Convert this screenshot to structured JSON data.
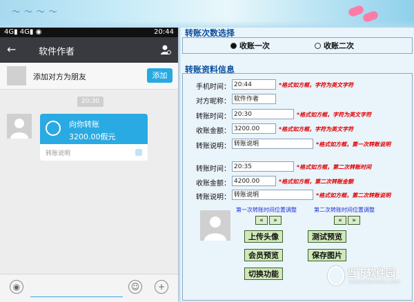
{
  "phone": {
    "status": {
      "left": "4G▮ 4G▮ ◉",
      "time": "20:44"
    },
    "title": "软件作者",
    "back_icon": "←",
    "friend": {
      "text": "添加对方为朋友",
      "button": "添加"
    },
    "time_pill": "20:30",
    "bubble": {
      "line1": "向你转账",
      "line2": "3200.00假元",
      "footer": "转账说明"
    },
    "input_icons": {
      "voice": "◉",
      "emoji": "☺",
      "plus": "+"
    }
  },
  "right": {
    "section1": "转账次数选择",
    "radio1": "收账一次",
    "radio2": "收账二次",
    "section2": "转账资料信息",
    "fields": [
      {
        "label": "手机时间：",
        "value": "20:44",
        "note": "*格式如方框，字符为英文字符"
      },
      {
        "label": "对方昵称：",
        "value": "软件作者",
        "note": ""
      },
      {
        "label": "转账时间：",
        "value": "20:30",
        "note": "*格式如方框，字符为英文字符"
      },
      {
        "label": "收账金额：",
        "value": "3200.00",
        "note": "*格式如方框，字符为英文字符"
      },
      {
        "label": "转账说明：",
        "value": "转账说明",
        "note": "*格式如方框，第一次转账说明"
      },
      {
        "label": "转账时间：",
        "value": "20:35",
        "note": "*格式如方框，第二次转账时间"
      },
      {
        "label": "收账金额：",
        "value": "4200.00",
        "note": "*格式如方框，第二次转账金额"
      },
      {
        "label": "转账说明：",
        "value": "转账说明",
        "note": "*格式如方框，第二次转账说明"
      }
    ],
    "adj1": "第一次转账时间位置调整",
    "adj2": "第二次转账时间位置调整",
    "arrow_left": "«",
    "arrow_right": "»",
    "buttons": {
      "upload": "上传头像",
      "test": "测试预览",
      "member": "会员预览",
      "save": "保存图片",
      "switch": "切换功能"
    },
    "watermark_a": "当下软件园",
    "watermark_b": "www.downxia.com"
  }
}
